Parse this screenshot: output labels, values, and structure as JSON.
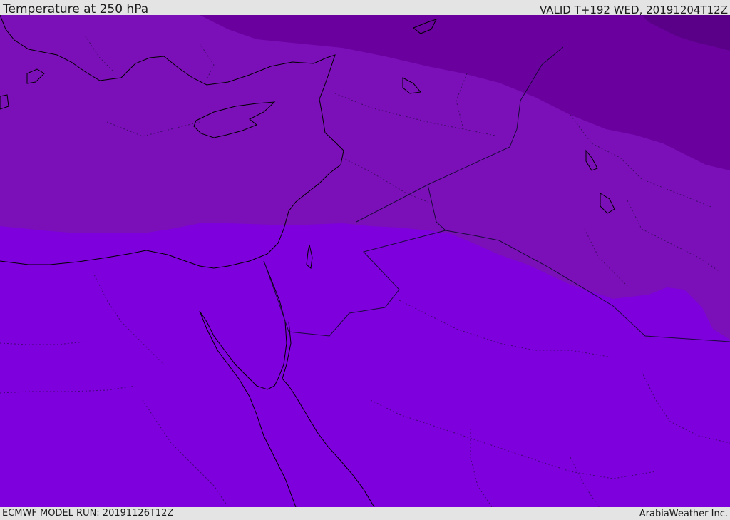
{
  "header": {
    "title": "Temperature at 250 hPa",
    "valid": "VALID T+192 WED, 20191204T12Z"
  },
  "footer": {
    "model_run": "ECMWF MODEL RUN: 20191126T12Z",
    "credit": "ArabiaWeather Inc."
  },
  "map": {
    "field": "temperature",
    "level": "250 hPa",
    "region": "Eastern Mediterranean / Middle East",
    "colors": {
      "warmest_band": "#7e00dc",
      "band_2": "#7b10b8",
      "band_3": "#6a009e",
      "coldest_band": "#5a0088",
      "coastline": "#000000",
      "border": "#1a0a3a"
    }
  }
}
